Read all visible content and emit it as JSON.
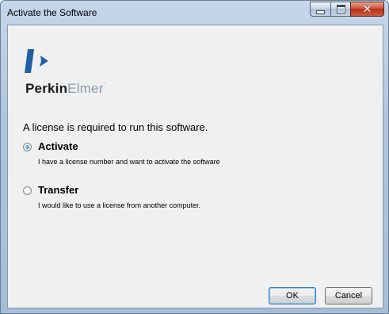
{
  "window": {
    "title": "Activate the Software",
    "minimize_label": "",
    "maximize_label": "",
    "close_label": "✕"
  },
  "logo": {
    "part1": "Perkin",
    "part2": "Elmer",
    "trademark": "'",
    "colors": {
      "mark": "#1f5fa6",
      "perkin": "#1a1a1a",
      "elmer": "#8a9aa8"
    }
  },
  "intro_text": "A license is required to run this software.",
  "options": [
    {
      "label": "Activate",
      "description": "I have a license number and want to activate the software",
      "selected": true
    },
    {
      "label": "Transfer",
      "description": "I would like to use a license from another computer.",
      "selected": false
    }
  ],
  "buttons": {
    "ok": "OK",
    "cancel": "Cancel"
  }
}
